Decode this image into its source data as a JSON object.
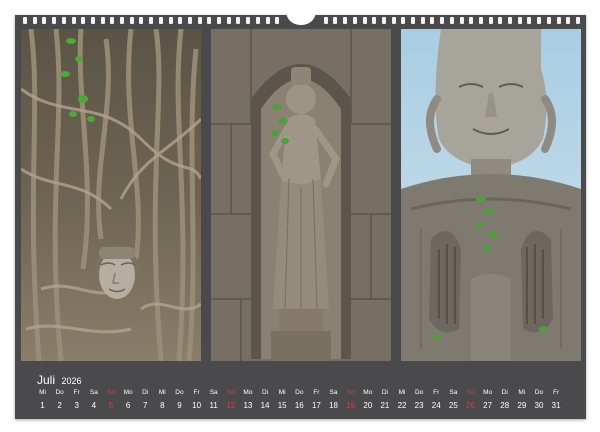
{
  "calendar": {
    "month": "Juli",
    "year": "2026",
    "sunday_color": "#e03a3a",
    "days": [
      {
        "wd": "Mi",
        "d": "1",
        "sun": false
      },
      {
        "wd": "Do",
        "d": "2",
        "sun": false
      },
      {
        "wd": "Fr",
        "d": "3",
        "sun": false
      },
      {
        "wd": "Sa",
        "d": "4",
        "sun": false
      },
      {
        "wd": "So",
        "d": "5",
        "sun": true
      },
      {
        "wd": "Mo",
        "d": "6",
        "sun": false
      },
      {
        "wd": "Di",
        "d": "7",
        "sun": false
      },
      {
        "wd": "Mi",
        "d": "8",
        "sun": false
      },
      {
        "wd": "Do",
        "d": "9",
        "sun": false
      },
      {
        "wd": "Fr",
        "d": "10",
        "sun": false
      },
      {
        "wd": "Sa",
        "d": "11",
        "sun": false
      },
      {
        "wd": "So",
        "d": "12",
        "sun": true
      },
      {
        "wd": "Mo",
        "d": "13",
        "sun": false
      },
      {
        "wd": "Di",
        "d": "14",
        "sun": false
      },
      {
        "wd": "Mi",
        "d": "15",
        "sun": false
      },
      {
        "wd": "Do",
        "d": "16",
        "sun": false
      },
      {
        "wd": "Fr",
        "d": "17",
        "sun": false
      },
      {
        "wd": "Sa",
        "d": "18",
        "sun": false
      },
      {
        "wd": "So",
        "d": "19",
        "sun": true
      },
      {
        "wd": "Mo",
        "d": "20",
        "sun": false
      },
      {
        "wd": "Di",
        "d": "21",
        "sun": false
      },
      {
        "wd": "Mi",
        "d": "22",
        "sun": false
      },
      {
        "wd": "Do",
        "d": "23",
        "sun": false
      },
      {
        "wd": "Fr",
        "d": "24",
        "sun": false
      },
      {
        "wd": "Sa",
        "d": "25",
        "sun": false
      },
      {
        "wd": "So",
        "d": "26",
        "sun": true
      },
      {
        "wd": "Mo",
        "d": "27",
        "sun": false
      },
      {
        "wd": "Di",
        "d": "28",
        "sun": false
      },
      {
        "wd": "Mi",
        "d": "29",
        "sun": false
      },
      {
        "wd": "Do",
        "d": "30",
        "sun": false
      },
      {
        "wd": "Fr",
        "d": "31",
        "sun": false
      }
    ]
  },
  "photos": [
    {
      "subject": "buddha-head-in-tree-roots"
    },
    {
      "subject": "apsara-stone-relief"
    },
    {
      "subject": "stone-buddha-statue"
    }
  ]
}
